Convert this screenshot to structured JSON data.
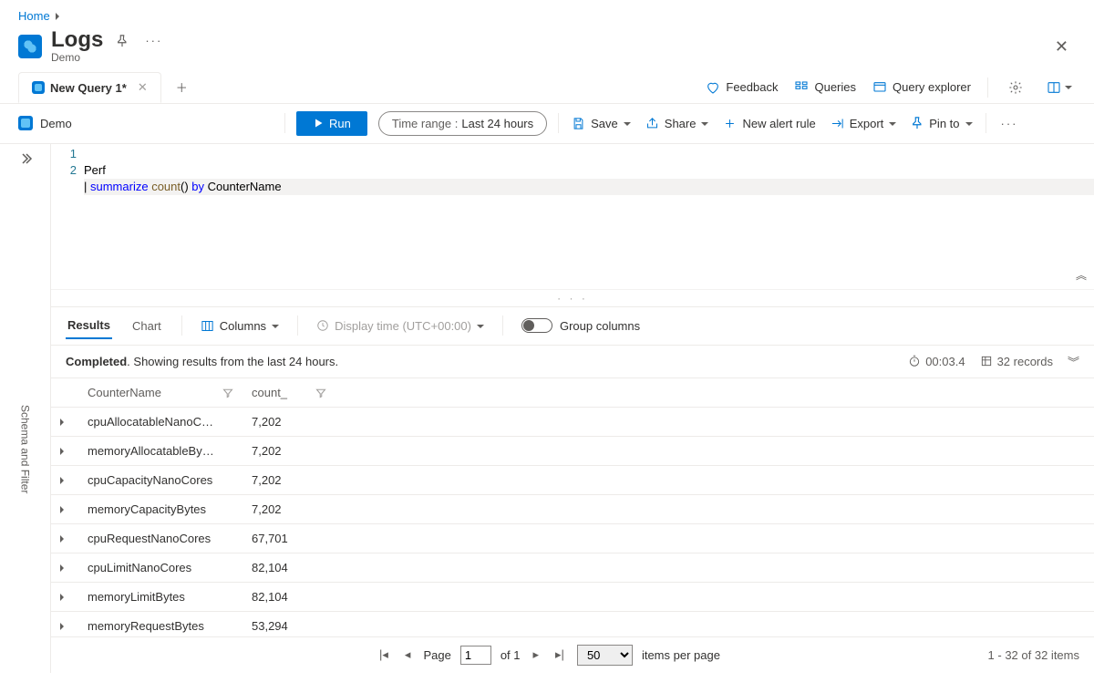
{
  "breadcrumb": {
    "home": "Home"
  },
  "header": {
    "title": "Logs",
    "subtitle": "Demo"
  },
  "tabs": [
    {
      "label": "New Query 1*"
    }
  ],
  "topRight": {
    "feedback": "Feedback",
    "queries": "Queries",
    "queryExplorer": "Query explorer"
  },
  "scope": {
    "name": "Demo"
  },
  "toolbar": {
    "run": "Run",
    "timeRangeLabel": "Time range :",
    "timeRangeValue": "Last 24 hours",
    "save": "Save",
    "share": "Share",
    "newAlert": "New alert rule",
    "export": "Export",
    "pin": "Pin to"
  },
  "sidePanel": {
    "schemaFilter": "Schema and Filter"
  },
  "editor": {
    "lines": [
      {
        "raw": "Perf"
      },
      {
        "raw": "| summarize count() by CounterName"
      }
    ]
  },
  "resultsTabs": {
    "results": "Results",
    "chart": "Chart",
    "columns": "Columns",
    "displayTime": "Display time (UTC+00:00)",
    "groupColumns": "Group columns"
  },
  "status": {
    "completed": "Completed",
    "message": ". Showing results from the last 24 hours.",
    "elapsed": "00:03.4",
    "records": "32 records"
  },
  "columns": [
    {
      "key": "CounterName",
      "label": "CounterName"
    },
    {
      "key": "count_",
      "label": "count_"
    }
  ],
  "rows": [
    {
      "CounterName": "cpuAllocatableNanoC…",
      "count_": "7,202"
    },
    {
      "CounterName": "memoryAllocatableBy…",
      "count_": "7,202"
    },
    {
      "CounterName": "cpuCapacityNanoCores",
      "count_": "7,202"
    },
    {
      "CounterName": "memoryCapacityBytes",
      "count_": "7,202"
    },
    {
      "CounterName": "cpuRequestNanoCores",
      "count_": "67,701"
    },
    {
      "CounterName": "cpuLimitNanoCores",
      "count_": "82,104"
    },
    {
      "CounterName": "memoryLimitBytes",
      "count_": "82,104"
    },
    {
      "CounterName": "memoryRequestBytes",
      "count_": "53,294"
    }
  ],
  "pager": {
    "pageLabel": "Page",
    "page": "1",
    "ofLabel": "of 1",
    "pageSize": "50",
    "perPage": "items per page",
    "summary": "1 - 32 of 32 items"
  }
}
